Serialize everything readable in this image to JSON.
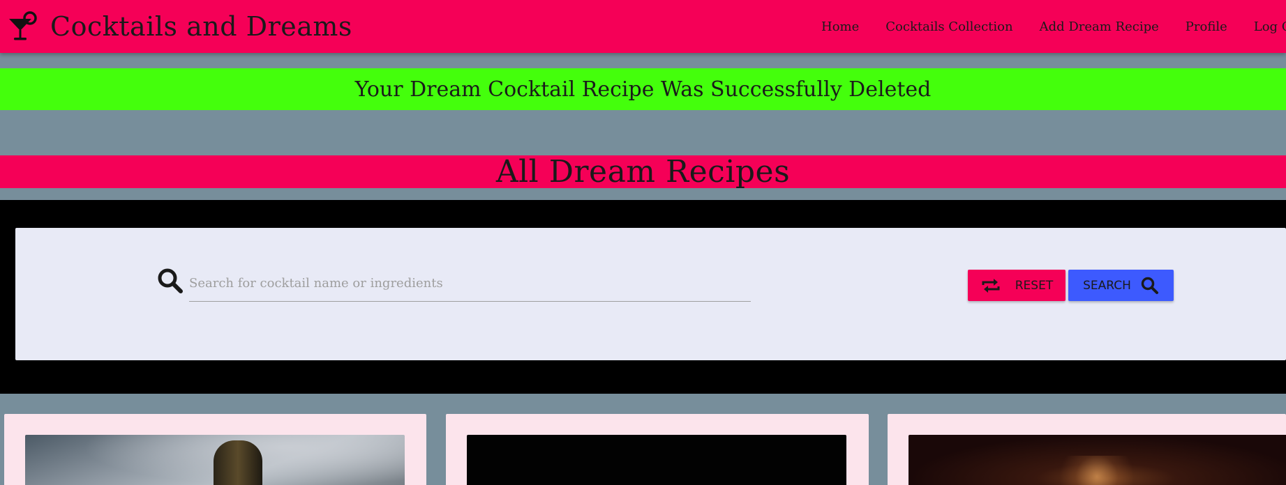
{
  "brand": {
    "title": "Cocktails and Dreams",
    "icon": "cocktail-glass-icon",
    "color": "#f50057"
  },
  "nav": {
    "items": [
      {
        "label": "Home"
      },
      {
        "label": "Cocktails Collection"
      },
      {
        "label": "Add Dream Recipe"
      },
      {
        "label": "Profile"
      },
      {
        "label": "Log Out"
      }
    ]
  },
  "flash": {
    "message": "Your Dream Cocktail Recipe Was Successfully Deleted",
    "color": "#44ff0c"
  },
  "section": {
    "heading": "All Dream Recipes"
  },
  "search": {
    "icon": "search-icon",
    "placeholder": "Search for cocktail name or ingredients",
    "value": "",
    "reset_label": "RESET",
    "reset_icon": "repeat-icon",
    "search_label": "SEARCH",
    "search_icon": "search-icon",
    "reset_color": "#f50057",
    "search_color": "#3d5afe"
  },
  "recipes": [
    {
      "image": "cocktail-photo-1"
    },
    {
      "image": "cocktail-photo-2"
    },
    {
      "image": "cocktail-photo-3"
    }
  ]
}
